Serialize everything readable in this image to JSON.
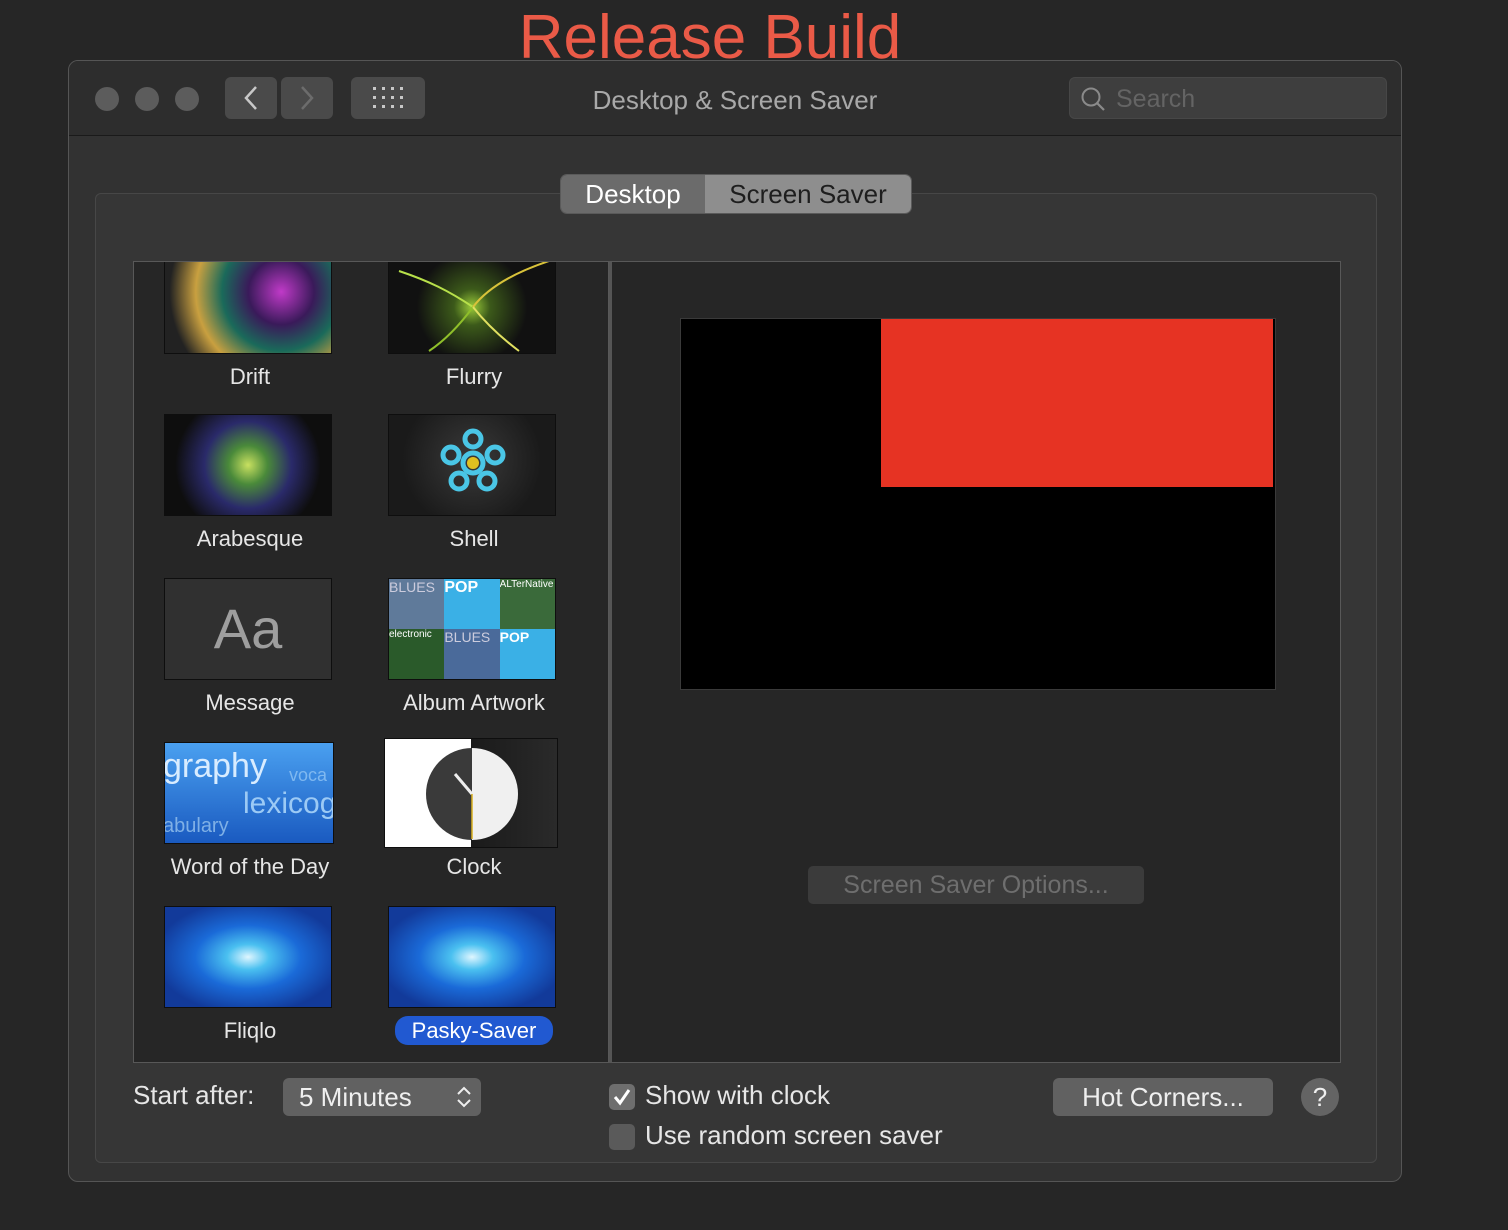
{
  "banner": {
    "text": "Release Build"
  },
  "window": {
    "title": "Desktop & Screen Saver",
    "search": {
      "placeholder": "Search"
    }
  },
  "tabs": [
    {
      "label": "Desktop",
      "active": true
    },
    {
      "label": "Screen Saver",
      "active": false
    }
  ],
  "savers": [
    {
      "name": "Drift",
      "selected": false
    },
    {
      "name": "Flurry",
      "selected": false
    },
    {
      "name": "Arabesque",
      "selected": false
    },
    {
      "name": "Shell",
      "selected": false
    },
    {
      "name": "Message",
      "selected": false
    },
    {
      "name": "Album Artwork",
      "selected": false
    },
    {
      "name": "Word of the Day",
      "selected": false
    },
    {
      "name": "Clock",
      "selected": false
    },
    {
      "name": "Fliqlo",
      "selected": false
    },
    {
      "name": "Pasky-Saver",
      "selected": true
    }
  ],
  "message_thumb": {
    "text": "Aa"
  },
  "word_thumb": {
    "w1": "graphy",
    "w2": "voca",
    "w3": "lexicog",
    "w4": "abulary"
  },
  "album_thumb": {
    "t1": "BLUES",
    "t2": "POP",
    "t3": "ALTerNative",
    "t4": "electronic"
  },
  "preview": {
    "options_button": "Screen Saver Options..."
  },
  "bottom": {
    "start_after_label": "Start after:",
    "start_after_value": "5 Minutes",
    "show_with_clock": {
      "label": "Show with clock",
      "checked": true
    },
    "random": {
      "label": "Use random screen saver",
      "checked": false
    },
    "hot_corners": "Hot Corners...",
    "help": "?"
  },
  "colors": {
    "banner": "#ea5a47",
    "selection": "#2159d1",
    "preview_rect": "#e63323"
  }
}
